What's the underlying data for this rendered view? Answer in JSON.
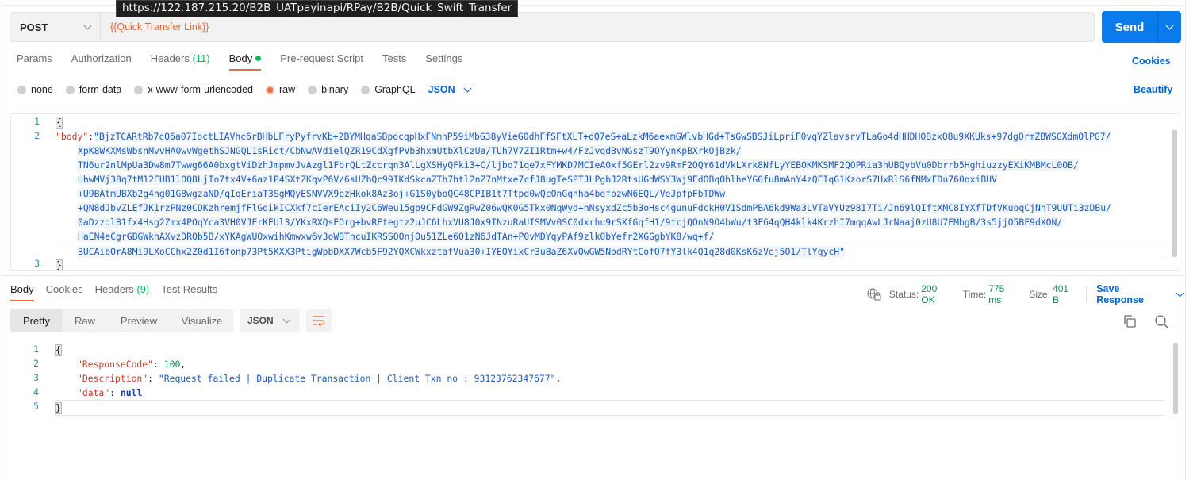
{
  "tooltip": {
    "url": "https://122.187.215.20/B2B_UATpayinapi/RPay/B2B/Quick_Swift_Transfer"
  },
  "request": {
    "method": "POST",
    "url_variable": "{{Quick Transfer Link}}",
    "send_label": "Send",
    "tabs": [
      {
        "label": "Params"
      },
      {
        "label": "Authorization"
      },
      {
        "label": "Headers",
        "count": "(11)"
      },
      {
        "label": "Body",
        "active": true
      },
      {
        "label": "Pre-request Script"
      },
      {
        "label": "Tests"
      },
      {
        "label": "Settings"
      }
    ],
    "cookies_label": "Cookies",
    "beautify_label": "Beautify",
    "body_types": [
      "none",
      "form-data",
      "x-www-form-urlencoded",
      "raw",
      "binary",
      "GraphQL"
    ],
    "selected_body_type": "raw",
    "language": "JSON",
    "editor": {
      "line_numbers": [
        "1",
        "2",
        "3"
      ],
      "open_brace": "{",
      "close_brace": "}",
      "key": "\"body\"",
      "colon": ":",
      "value_lines": [
        "\"BjzTCARtRb7cQ6a07IoctLIAVhc6rBHbLFryPyfrvKb+2BYMHqaSBpocqpHxFNmnP59iMbG38yVieG0dhFfSFtXLT+dQ7eS+aLzkM6aexmGWlvbHGd+TsGwSBSJiLpriF0vqYZlavsrvTLaGo4dHHDHOBzxQ8u9XKUks+97dgQrmZBWSGXdmOlPG7/",
        "XpK8WKXMsWbsnMvvHA0wvWgethSJNGQL1sRict/CbNwAVdielQZR19CdXgfPVb3hxmUtbXlCzUa/TUh7V7ZI1Rtm+w4/FzJvqdBvNGszT9OYynKpBXrkOjBzk/",
        "TN6ur2nlMpUa3Dw8m7Twwg66A0bxgtViDzhJmpmvJvAzgl1FbrQLtZccrqn3AlLgXSHyQFki3+C/ljbo71qe7xFYMKD7MCIeA0xf5GErl2zv9RmF2OQY61dVkLXrk8NfLyYEBOKMKSMF2QOPRia3hUBQybVu0Dbrrb5HghiuzzyEXiKMBMcL0OB/",
        "UhwMVj38q7tM12EUB1lOQ8LjTo7tx4V+6az1P4SXtZKqvP6V/6sUZbQc99IKdSkcaZTh7htl2nZ7nMtxe7cfJ8ugTeSPTJLPgbJ2RtsUGdWSY3Wj9EdOBqOhlheYG0fu8mAnY4zQEIqG1KzorS7HxRlS6fNMxFDu760oxiBUV",
        "+U9BAtmUBXb2g4hg01G8wgzaND/qIqEriaT3SgMQyESNVVX9pzHkok8Az3oj+G1S0yboQC48CPIB1t7Ttpd0wQcOnGqhha4befpzwN6EQL/VeJpfpFbTDWw",
        "+QN8dJbvZLEfJK1rzPNz0CDKzhremjfFlGqikICXkf7cIerEAciIy2C6Weu15gp9CFdGW9ZgRwZ06wQK0G5Tkx0NqWyd+nNsyxdZc5b3oHsc4gunuFdckH0V1SdmPBA6kd9Wa3LVTaVYUz98I7Ti/Jn69lQIftXMC8IYXfTDfVKuoqCjNhT9UUTi3zDBu/",
        "0aDzzdl81fx4Hsg2Zmx4POqYca3VH0VJErKEUl3/YKxRXQsEOrg+bvRFtegtz2uJC6LhxVU8J0x9INzuRaUISMVv0SC0dxrhu9rSXfGqfH1/9tcjQOnN9O4bWu/t3F64qQH4klk4KrzhI7mqqAwLJrNaaj0zU8U7EMbgB/3s5jjO5BF9dXON/",
        "HaEN4eCgrGBGWkhAXvzDRQb5B/xYKAgWUQxwihKmwxw6v3oWBTncuIKRSSOOnjOu51ZLe6O1zN6JdTAn+P0vMDYqyPAf9zlk0bYefr2XGGgbYK8/wq+f/",
        "BUCAibOrA8Mi9LXoCChx2Z0d1I6fonp73Pt5KXX3PtigWpbDXX7Wcb5F92YQXCWkxztafVua30+IYEQYixCr3u8aZ6XVQwGW5NodRYtCofQ7fY3lk4Q1q28d0KsK6zVej5O1/TlYqycH\""
      ]
    }
  },
  "response": {
    "tabs": [
      {
        "label": "Body",
        "active": true
      },
      {
        "label": "Cookies"
      },
      {
        "label": "Headers",
        "count": "(9)"
      },
      {
        "label": "Test Results"
      }
    ],
    "status_label": "Status:",
    "status_value": "200 OK",
    "time_label": "Time:",
    "time_value": "775 ms",
    "size_label": "Size:",
    "size_value": "401 B",
    "save_response_label": "Save Response",
    "view_modes": [
      "Pretty",
      "Raw",
      "Preview",
      "Visualize"
    ],
    "selected_view": "Pretty",
    "format": "JSON",
    "editor": {
      "line_numbers": [
        "1",
        "2",
        "3",
        "4",
        "5"
      ],
      "open_brace": "{",
      "close_brace": "}",
      "lines": [
        {
          "key": "\"ResponseCode\"",
          "value": "100",
          "type": "num",
          "trail": ","
        },
        {
          "key": "\"Description\"",
          "value": "\"Request failed | Duplicate Transaction | Client Txn no : 93123762347677\"",
          "type": "str",
          "trail": ","
        },
        {
          "key": "\"data\"",
          "value": "null",
          "type": "nul",
          "trail": ""
        }
      ]
    }
  },
  "colors": {
    "accent": "#f26b3a",
    "primary": "#097bed",
    "link": "#0265d2",
    "success": "#0a8f56"
  }
}
